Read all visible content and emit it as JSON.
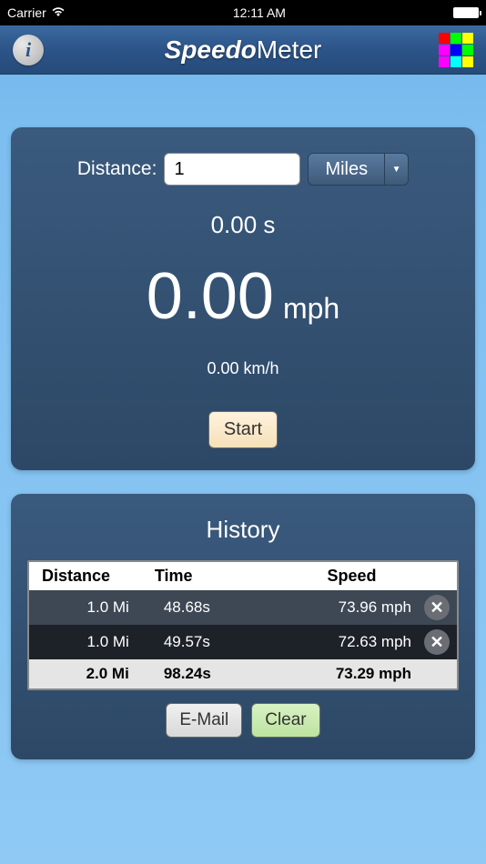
{
  "statusBar": {
    "carrier": "Carrier",
    "time": "12:11 AM"
  },
  "header": {
    "titleBold": "Speedo",
    "titleThin": "Meter"
  },
  "main": {
    "distanceLabel": "Distance:",
    "distanceValue": "1",
    "unitSelected": "Miles",
    "time": "0.00 s",
    "speedValue": "0.00",
    "speedUnit": "mph",
    "speedAlt": "0.00 km/h",
    "startLabel": "Start"
  },
  "history": {
    "title": "History",
    "headers": {
      "distance": "Distance",
      "time": "Time",
      "speed": "Speed"
    },
    "rows": [
      {
        "distance": "1.0 Mi",
        "time": "48.68s",
        "speed": "73.96 mph"
      },
      {
        "distance": "1.0 Mi",
        "time": "49.57s",
        "speed": "72.63 mph"
      }
    ],
    "total": {
      "distance": "2.0 Mi",
      "time": "98.24s",
      "speed": "73.29 mph"
    },
    "emailLabel": "E-Mail",
    "clearLabel": "Clear"
  },
  "colors": [
    "#ff0000",
    "#00ff00",
    "#ffff00",
    "#ff00ff",
    "#0000ff",
    "#00ff00",
    "#ff00ff",
    "#00ffff",
    "#ffff00"
  ]
}
